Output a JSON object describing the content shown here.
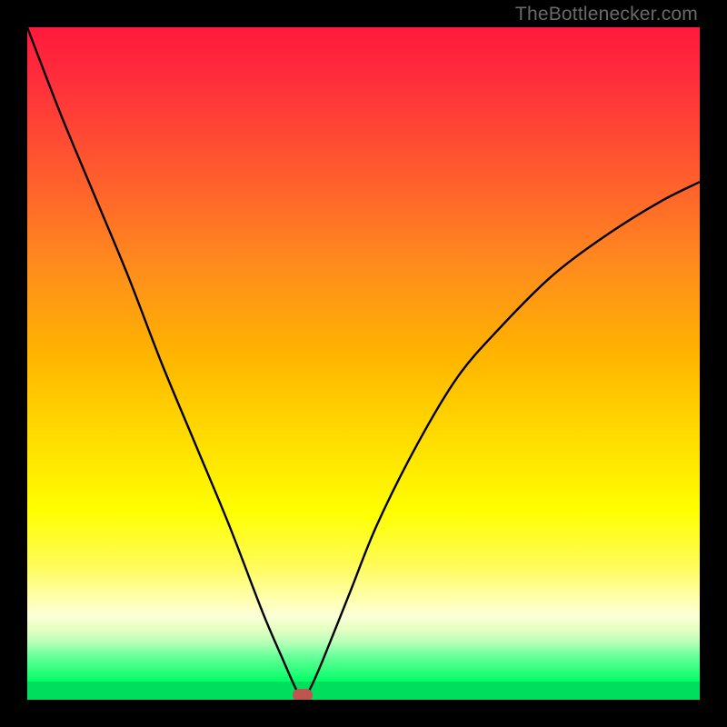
{
  "watermark": {
    "text": "TheBottlenecker.com"
  },
  "chart_data": {
    "type": "line",
    "title": "",
    "xlabel": "",
    "ylabel": "",
    "xlim": [
      0,
      100
    ],
    "ylim": [
      0,
      100
    ],
    "legend": false,
    "grid": false,
    "background": "red-to-green vertical gradient",
    "min_point": {
      "x": 41,
      "y": 0
    },
    "series": [
      {
        "name": "bottleneck-curve",
        "x": [
          0,
          5,
          10,
          15,
          20,
          25,
          30,
          35,
          38,
          40,
          41,
          42,
          44,
          48,
          52,
          58,
          64,
          70,
          78,
          86,
          94,
          100
        ],
        "values": [
          100,
          87,
          75,
          63,
          50,
          38,
          26,
          13,
          6,
          1.5,
          0,
          1.5,
          6,
          16,
          26,
          38,
          48,
          55,
          63,
          69,
          74,
          77
        ]
      }
    ],
    "marker": {
      "x": 41,
      "y": 0,
      "color": "#c0544e"
    }
  },
  "colors": {
    "frame": "#000000",
    "curve": "#000000",
    "marker": "#c0544e",
    "watermark": "#6a6a6a"
  }
}
